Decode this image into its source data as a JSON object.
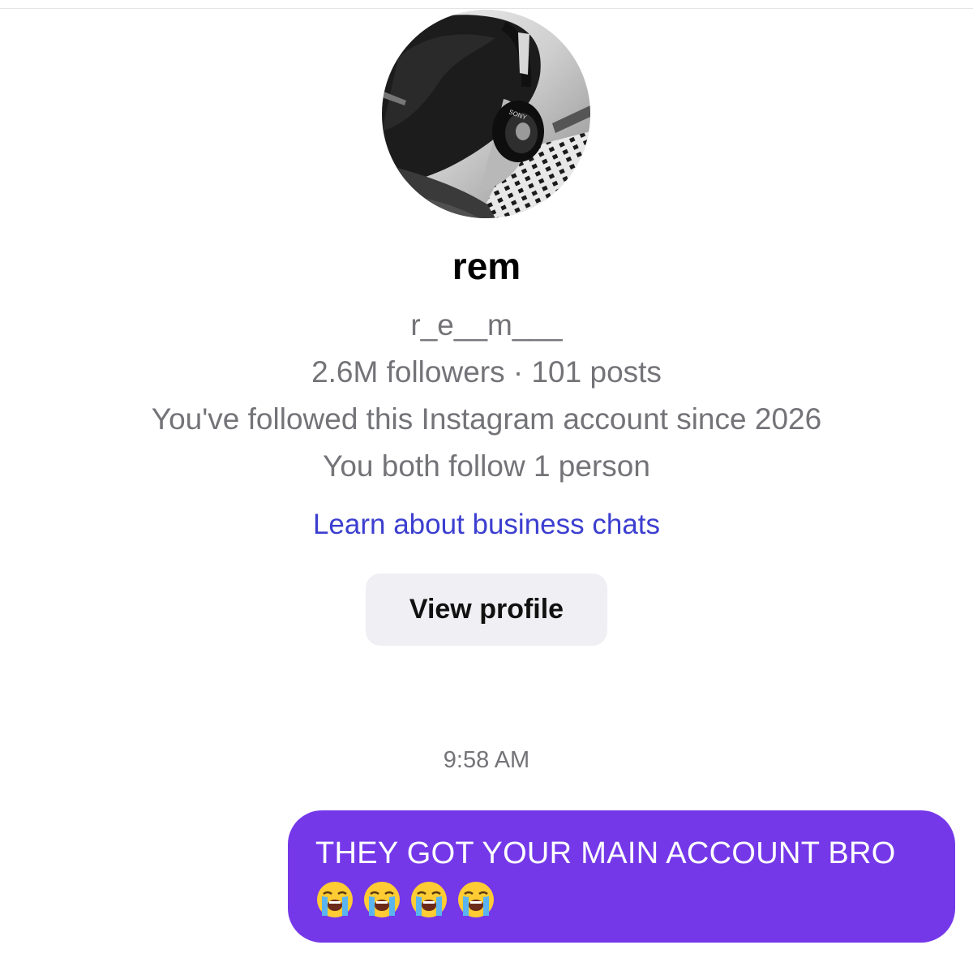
{
  "profile": {
    "display_name": "rem",
    "username": "r_e__m___",
    "stats": "2.6M followers · 101 posts",
    "followed_since": "You've followed this Instagram account since 2026",
    "mutuals": "You both follow 1 person",
    "learn_link": "Learn about business chats",
    "view_profile_label": "View profile",
    "avatar_icon": "profile-photo-headphones"
  },
  "conversation": {
    "timestamp": "9:58 AM",
    "messages": [
      {
        "sender": "self",
        "text": "THEY GOT YOUR MAIN ACCOUNT BRO",
        "emojis": [
          "😭",
          "😭",
          "😭",
          "😭"
        ],
        "emoji_icon": "loudly-crying-face-icon"
      }
    ]
  },
  "colors": {
    "bubble": "#7438e9",
    "link": "#3c3fcf",
    "secondary_text": "#737378",
    "button_bg": "#efeff4"
  }
}
